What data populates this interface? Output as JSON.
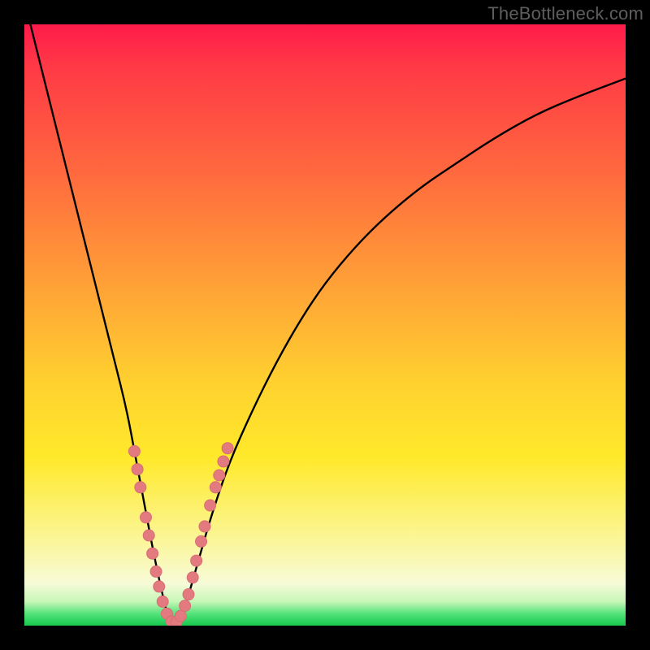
{
  "watermark": "TheBottleneck.com",
  "colors": {
    "frame": "#000000",
    "curve": "#000000",
    "marker_fill": "#e27a7f",
    "marker_stroke": "#d76e74",
    "gradient_top": "#ff1b49",
    "gradient_bottom": "#18c94f"
  },
  "chart_data": {
    "type": "line",
    "title": "",
    "xlabel": "",
    "ylabel": "",
    "xlim": [
      0,
      100
    ],
    "ylim": [
      0,
      100
    ],
    "grid": false,
    "legend": false,
    "series": [
      {
        "name": "bottleneck-curve",
        "x": [
          1,
          3,
          5,
          7,
          9,
          11,
          13,
          15,
          17,
          18.5,
          20,
          21.5,
          23,
          24,
          25,
          26,
          27,
          29,
          31,
          34,
          38,
          42,
          46,
          50,
          55,
          60,
          66,
          72,
          78,
          85,
          92,
          100
        ],
        "y": [
          100,
          92,
          84,
          76,
          68,
          60,
          52,
          44,
          36,
          28,
          20,
          12,
          5,
          1,
          0,
          1,
          4,
          11,
          18,
          27,
          36,
          44,
          51,
          57,
          63,
          68,
          73,
          77,
          81,
          85,
          88,
          91
        ]
      }
    ],
    "markers": [
      {
        "x": 18.3,
        "y": 29
      },
      {
        "x": 18.8,
        "y": 26
      },
      {
        "x": 19.3,
        "y": 23
      },
      {
        "x": 20.2,
        "y": 18
      },
      {
        "x": 20.7,
        "y": 15
      },
      {
        "x": 21.3,
        "y": 12
      },
      {
        "x": 21.9,
        "y": 9
      },
      {
        "x": 22.4,
        "y": 6.5
      },
      {
        "x": 23.0,
        "y": 4
      },
      {
        "x": 23.7,
        "y": 2
      },
      {
        "x": 24.5,
        "y": 0.7
      },
      {
        "x": 25.3,
        "y": 0.6
      },
      {
        "x": 26.0,
        "y": 1.6
      },
      {
        "x": 26.7,
        "y": 3.3
      },
      {
        "x": 27.3,
        "y": 5.2
      },
      {
        "x": 28.0,
        "y": 8
      },
      {
        "x": 28.6,
        "y": 10.8
      },
      {
        "x": 29.4,
        "y": 14
      },
      {
        "x": 30.0,
        "y": 16.5
      },
      {
        "x": 30.9,
        "y": 20
      },
      {
        "x": 31.8,
        "y": 23
      },
      {
        "x": 32.4,
        "y": 25
      },
      {
        "x": 33.1,
        "y": 27.3
      },
      {
        "x": 33.8,
        "y": 29.5
      }
    ]
  }
}
